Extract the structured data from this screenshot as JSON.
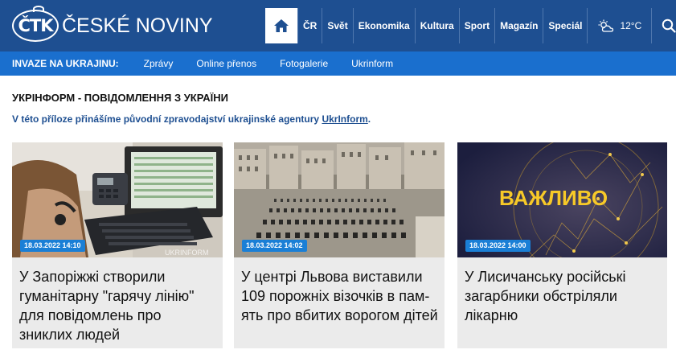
{
  "header": {
    "logo_mark": "ČTK",
    "logo_name": "ČESKÉ NOVINY",
    "nav": [
      "ČR",
      "Svět",
      "Ekonomika",
      "Kultura",
      "Sport",
      "Magazín",
      "Speciál"
    ],
    "weather": "12°C"
  },
  "subnav": {
    "label": "INVAZE NA UKRAJINU:",
    "links": [
      "Zprávy",
      "Online přenos",
      "Fotogalerie",
      "Ukrinform"
    ]
  },
  "page": {
    "title": "УКРІНФОРМ - ПОВІДОМЛЕННЯ З УКРАЇНИ",
    "intro_before": "V této příloze přinášíme původní zpravodajství ukrajinské agentury ",
    "intro_link": "UkrInform",
    "intro_after": "."
  },
  "cards": [
    {
      "date": "18.03.2022 14:10",
      "title": "У Запоріжжі створили гуманітарну \"гарячу лінію\" для повідомлень про зниклих людей",
      "watermark": "UKRINFORM"
    },
    {
      "date": "18.03.2022 14:02",
      "title": "У центрі Львова виставили 109 порожніх візочків в пам-ять про вбитих ворогом дітей"
    },
    {
      "date": "18.03.2022 14:00",
      "title": "У Лисичанську російські загарбники обстріляли лікарню",
      "image_text": "ВАЖЛИВО"
    }
  ]
}
